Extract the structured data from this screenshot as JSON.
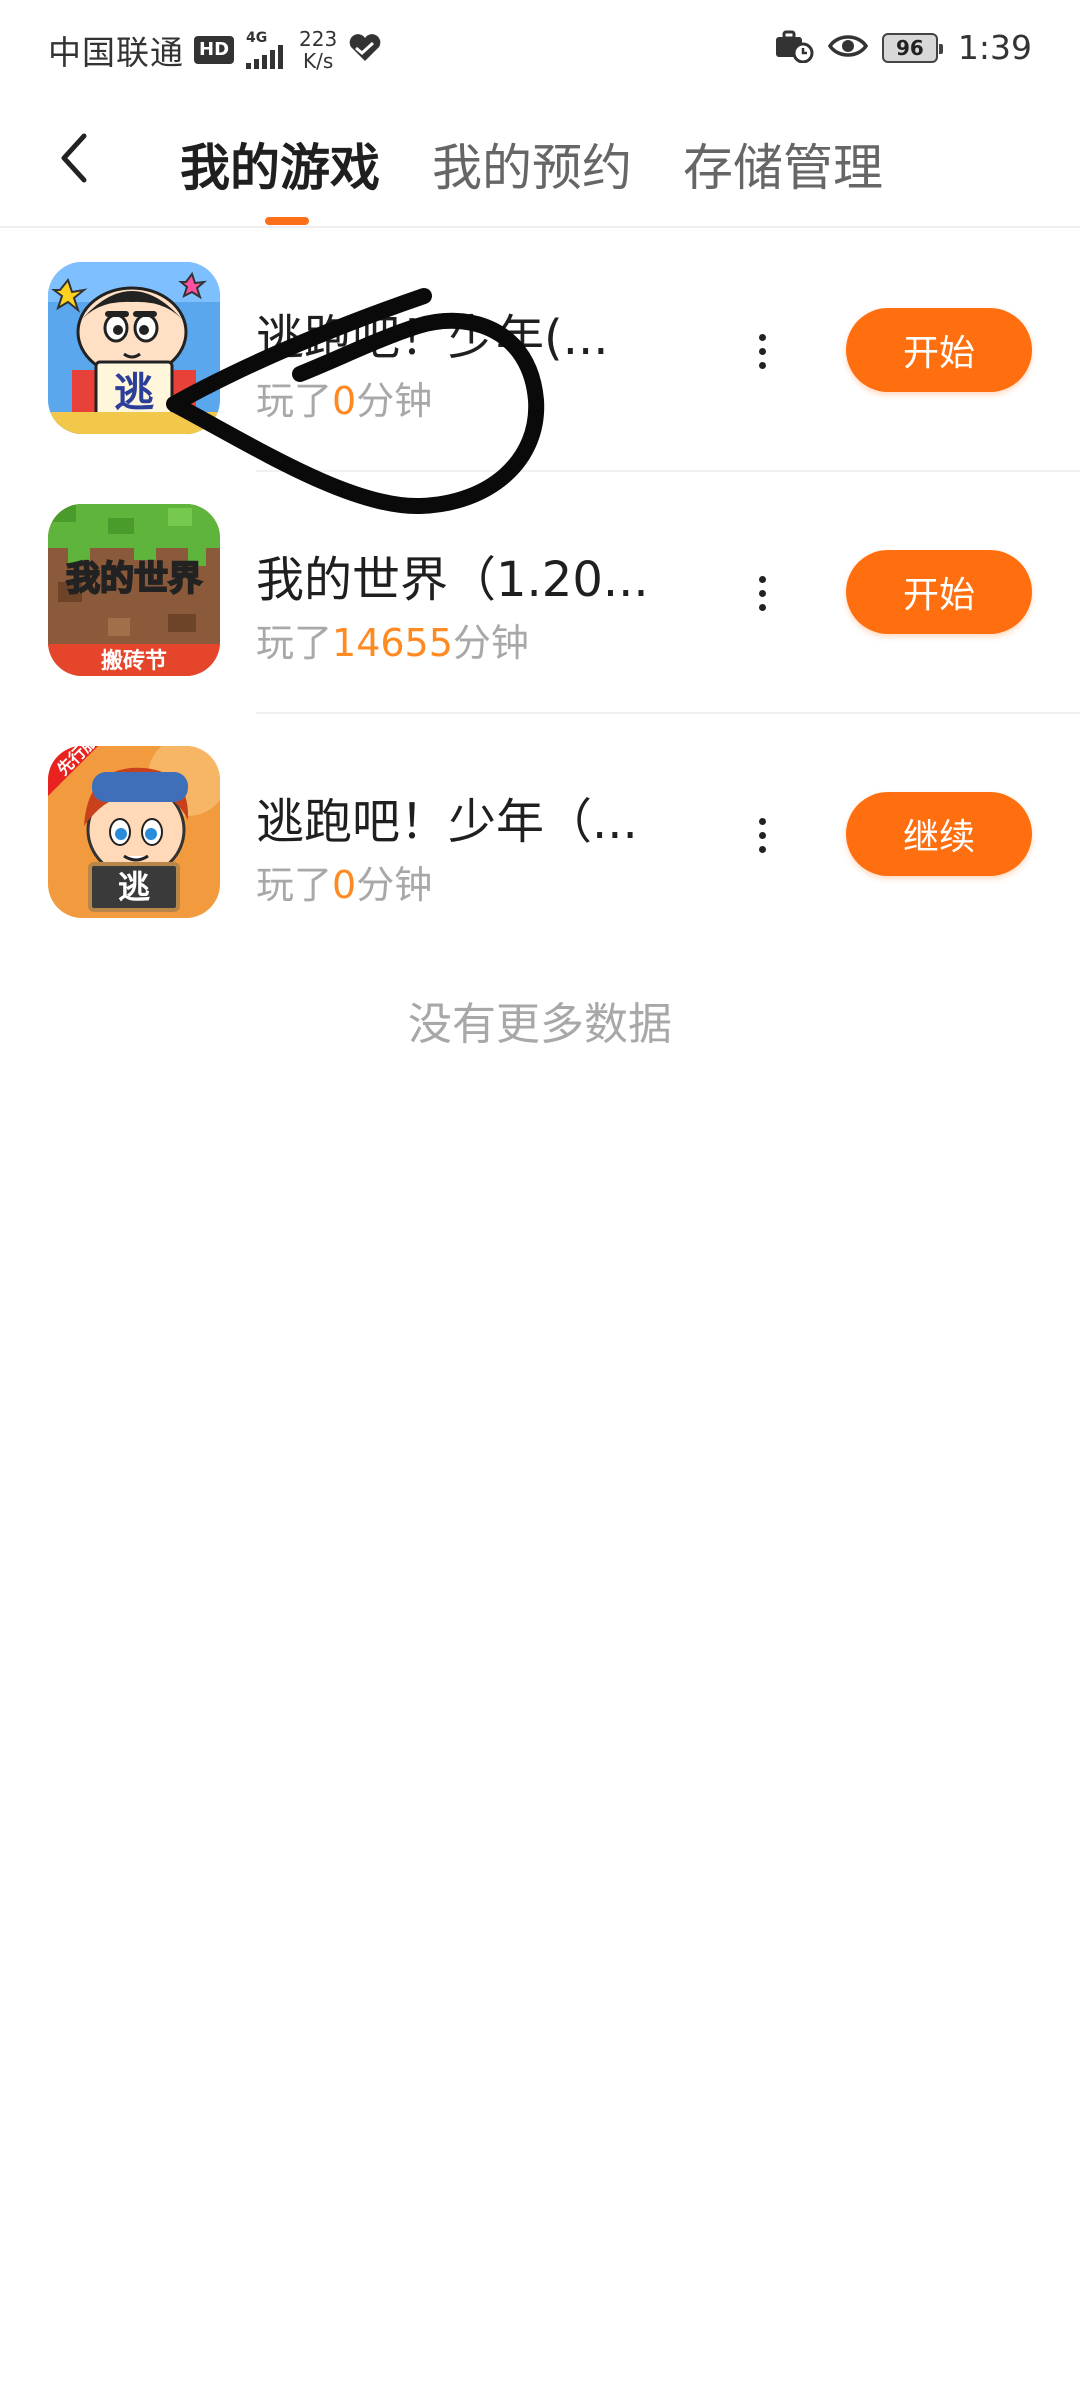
{
  "status_bar": {
    "carrier": "中国联通",
    "hd": "HD",
    "network": "4G",
    "speed_value": "223",
    "speed_unit": "K/s",
    "battery": "96",
    "time": "1:39"
  },
  "header": {
    "tabs": [
      {
        "label": "我的游戏",
        "active": true
      },
      {
        "label": "我的预约",
        "active": false
      },
      {
        "label": "存储管理",
        "active": false
      }
    ],
    "accent_color": "#ff6f1a"
  },
  "games": [
    {
      "title": "逃跑吧！少年(...",
      "played_prefix": "玩了",
      "minutes": "0",
      "played_suffix": "分钟",
      "action": "开始",
      "icon": "crayon-shin-chan-escape-icon"
    },
    {
      "title": "我的世界（1.20...",
      "played_prefix": "玩了",
      "minutes": "14655",
      "played_suffix": "分钟",
      "action": "开始",
      "icon": "minecraft-icon",
      "icon_text_top": "我的世界",
      "icon_text_bottom": "搬砖节"
    },
    {
      "title": "逃跑吧！少年（...",
      "played_prefix": "玩了",
      "minutes": "0",
      "played_suffix": "分钟",
      "action": "继续",
      "icon": "escape-boy-icon",
      "icon_badge": "先行服",
      "icon_sign": "逃"
    }
  ],
  "footer_text": "没有更多数据"
}
